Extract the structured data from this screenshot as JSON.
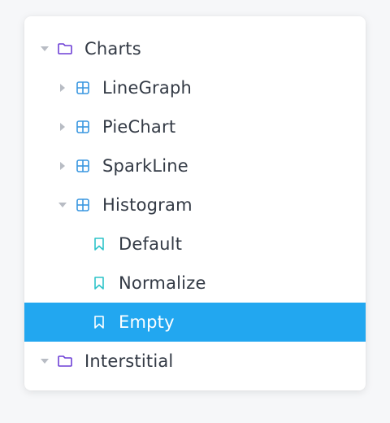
{
  "colors": {
    "accent": "#22a7f0",
    "folder_icon": "#6d3fd6",
    "grid_icon": "#3a97e0",
    "bookmark_icon": "#2ec4c9",
    "caret": "#b8bcc4"
  },
  "tree": {
    "nodes": [
      {
        "label": "Charts",
        "icon": "folder-icon",
        "caret": "expanded",
        "depth": 0,
        "selected": false
      },
      {
        "label": "LineGraph",
        "icon": "grid-icon",
        "caret": "collapsed",
        "depth": 1,
        "selected": false
      },
      {
        "label": "PieChart",
        "icon": "grid-icon",
        "caret": "collapsed",
        "depth": 1,
        "selected": false
      },
      {
        "label": "SparkLine",
        "icon": "grid-icon",
        "caret": "collapsed",
        "depth": 1,
        "selected": false
      },
      {
        "label": "Histogram",
        "icon": "grid-icon",
        "caret": "expanded",
        "depth": 1,
        "selected": false
      },
      {
        "label": "Default",
        "icon": "bookmark-icon",
        "caret": "none",
        "depth": 2,
        "selected": false
      },
      {
        "label": "Normalize",
        "icon": "bookmark-icon",
        "caret": "none",
        "depth": 2,
        "selected": false
      },
      {
        "label": "Empty",
        "icon": "bookmark-icon",
        "caret": "none",
        "depth": 2,
        "selected": true
      },
      {
        "label": "Interstitial",
        "icon": "folder-icon",
        "caret": "expanded",
        "depth": 0,
        "selected": false
      }
    ]
  }
}
